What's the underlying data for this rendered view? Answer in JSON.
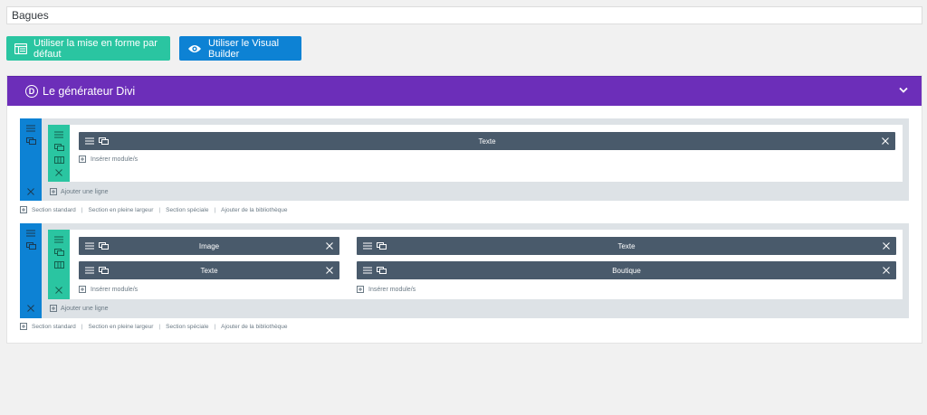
{
  "title_input": {
    "value": "Bagues"
  },
  "buttons": {
    "default_layout": "Utiliser la mise en forme par défaut",
    "visual_builder": "Utiliser le Visual Builder"
  },
  "builder": {
    "title": "Le générateur Divi",
    "logo_letter": "D"
  },
  "sections": [
    {
      "columns": [
        {
          "modules": [
            {
              "name": "Texte"
            }
          ],
          "insert_label": "Insérer module/s"
        }
      ],
      "add_row_label": "Ajouter une ligne"
    },
    {
      "columns": [
        {
          "modules": [
            {
              "name": "Image"
            },
            {
              "name": "Texte"
            }
          ],
          "insert_label": "Insérer module/s"
        },
        {
          "modules": [
            {
              "name": "Texte"
            },
            {
              "name": "Boutique"
            }
          ],
          "insert_label": "Insérer module/s"
        }
      ],
      "add_row_label": "Ajouter une ligne"
    }
  ],
  "section_links": [
    {
      "labels": [
        "Section standard",
        "Section en pleine largeur",
        "Section spéciale",
        "Ajouter de la bibliothèque"
      ]
    },
    {
      "labels": [
        "Section standard",
        "Section en pleine largeur",
        "Section spéciale",
        "Ajouter de la bibliothèque"
      ]
    }
  ],
  "colors": {
    "purple_header": "#6c2eb9",
    "section_blue": "#0d82d4",
    "row_green": "#2ac5a1",
    "module_slate": "#495a6b",
    "section_bg": "#dde2e6"
  },
  "icons": [
    "layout-icon",
    "eye-icon",
    "divi-logo-icon",
    "chevron-down-icon",
    "hamburger-icon",
    "duplicate-icon",
    "columns-icon",
    "close-icon",
    "plus-square-icon"
  ]
}
